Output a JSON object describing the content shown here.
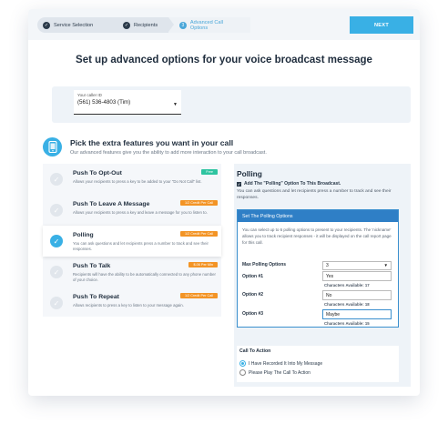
{
  "steps": [
    {
      "label": "Service Selection",
      "state": "done"
    },
    {
      "label": "Recipients",
      "state": "done"
    },
    {
      "label": "Advanced Call Options",
      "state": "current",
      "number": "3"
    }
  ],
  "next_label": "NEXT",
  "page_title": "Set up advanced options for your voice broadcast message",
  "caller": {
    "label": "Your caller ID",
    "value": "(561) 536-4803 (Tim)"
  },
  "features_section": {
    "title": "Pick the extra features you want in your call",
    "subtitle": "Our advanced features give you the ability to add more interaction to your call broadcast."
  },
  "features": [
    {
      "name": "Push To Opt-Out",
      "desc": "Allows your recipients to press a key to be added to your \"Do Not Call\" list.",
      "badge": "Free",
      "badge_type": "free",
      "selected": false
    },
    {
      "name": "Push To Leave A Message",
      "desc": "Allows your recipients to press a key and leave a message for you to listen to.",
      "badge": "1/2 Credit Per Call",
      "badge_type": "orange",
      "selected": false
    },
    {
      "name": "Polling",
      "desc": "You can ask questions and let recipients press a number to track and see their responses.",
      "badge": "1/2 Credit Per Call",
      "badge_type": "orange",
      "selected": true
    },
    {
      "name": "Push To Talk",
      "desc": "Recipients will have the ability to be automatically connected to any phone number of your choice.",
      "badge": "$.06 Per Min",
      "badge_type": "orange",
      "selected": false
    },
    {
      "name": "Push To Repeat",
      "desc": "Allows recipients to press a key to listen to your message again.",
      "badge": "1/2 Credit Per Call",
      "badge_type": "orange",
      "selected": false
    }
  ],
  "polling": {
    "title": "Polling",
    "add_label": "Add The \"Polling\" Option To This Broadcast.",
    "desc": "You can ask questions and let recipients press a number to track and see their responses.",
    "settings_title": "Set The Polling Options",
    "settings_desc": "You can select up to 6 polling options to present to your recipients. The 'nickname' allows you to track recipient responses - it will be displayed on the call report page for this call.",
    "max_label": "Max Polling Options",
    "max_value": "3",
    "options": [
      {
        "label": "Option #1",
        "value": "Yes",
        "chars": "Characters Available: 17"
      },
      {
        "label": "Option #2",
        "value": "No",
        "chars": "Characters Available: 18"
      },
      {
        "label": "Option #3",
        "value": "Maybe",
        "chars": "Characters Available: 15"
      }
    ]
  },
  "cta": {
    "title": "Call To Action",
    "options": [
      "I Have Recorded It Into My Message",
      "Please Play The Call To Action"
    ],
    "selected": 0
  },
  "colors": {
    "accent": "#39b0e5",
    "panel_header": "#2f7fc6",
    "free_badge": "#2ec4a0",
    "orange_badge": "#f39425"
  }
}
